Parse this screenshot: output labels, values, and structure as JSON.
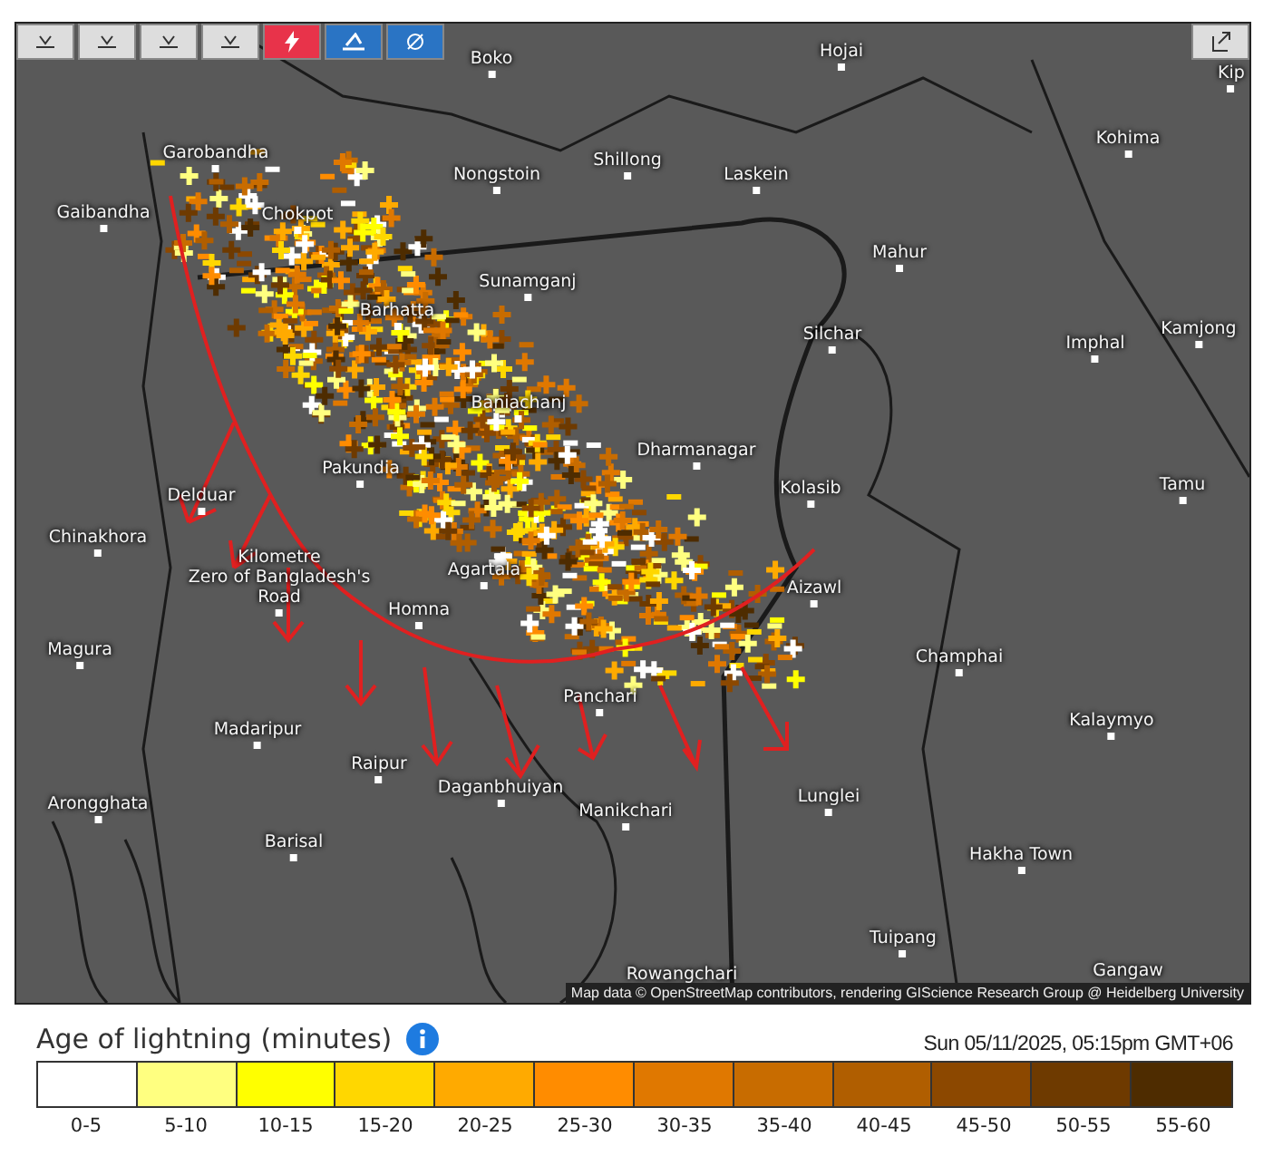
{
  "map": {
    "places": [
      {
        "name": "Boko"
      },
      {
        "name": "Hojai"
      },
      {
        "name": "Kip"
      },
      {
        "name": "Kohima"
      },
      {
        "name": "Garobandha"
      },
      {
        "name": "Nongstoin"
      },
      {
        "name": "Shillong"
      },
      {
        "name": "Laskein"
      },
      {
        "name": "Gaibandha"
      },
      {
        "name": "Chokpot"
      },
      {
        "name": "Mahur"
      },
      {
        "name": "Sunamganj"
      },
      {
        "name": "Barhatta"
      },
      {
        "name": "Silchar"
      },
      {
        "name": "Imphal"
      },
      {
        "name": "Kamjong"
      },
      {
        "name": "Baniachanj"
      },
      {
        "name": "Dharmanagar"
      },
      {
        "name": "Kolasib"
      },
      {
        "name": "Tamu"
      },
      {
        "name": "Pakundia"
      },
      {
        "name": "Delduar"
      },
      {
        "name": "Chinakhora"
      },
      {
        "name": "Kilometre Zero of Bangladesh's Road"
      },
      {
        "name": "Agartala"
      },
      {
        "name": "Homna"
      },
      {
        "name": "Aizawl"
      },
      {
        "name": "Magura"
      },
      {
        "name": "Champhai"
      },
      {
        "name": "Panchari"
      },
      {
        "name": "Madaripur"
      },
      {
        "name": "Kalaymyo"
      },
      {
        "name": "Raipur"
      },
      {
        "name": "Daganbhuiyan"
      },
      {
        "name": "Manikchari"
      },
      {
        "name": "Lunglei"
      },
      {
        "name": "Arongghata"
      },
      {
        "name": "Barisal"
      },
      {
        "name": "Hakha Town"
      },
      {
        "name": "Tuipang"
      },
      {
        "name": "Rowangchari"
      },
      {
        "name": "Gangaw"
      }
    ],
    "attribution": "Map data © OpenStreetMap contributors, rendering GIScience Research Group @ Heidelberg University"
  },
  "legend": {
    "title": "Age of lightning (minutes)",
    "timestamp": "Sun 05/11/2025, 05:15pm GMT+06",
    "bins": [
      {
        "label": "0-5",
        "color": "#ffffff"
      },
      {
        "label": "5-10",
        "color": "#ffff80"
      },
      {
        "label": "10-15",
        "color": "#ffff00"
      },
      {
        "label": "15-20",
        "color": "#ffd700"
      },
      {
        "label": "20-25",
        "color": "#ffaa00"
      },
      {
        "label": "25-30",
        "color": "#ff8c00"
      },
      {
        "label": "30-35",
        "color": "#e07800"
      },
      {
        "label": "35-40",
        "color": "#c86c00"
      },
      {
        "label": "40-45",
        "color": "#b05e00"
      },
      {
        "label": "45-50",
        "color": "#8c4800"
      },
      {
        "label": "50-55",
        "color": "#6e3a00"
      },
      {
        "label": "55-60",
        "color": "#4e2c00"
      }
    ]
  }
}
